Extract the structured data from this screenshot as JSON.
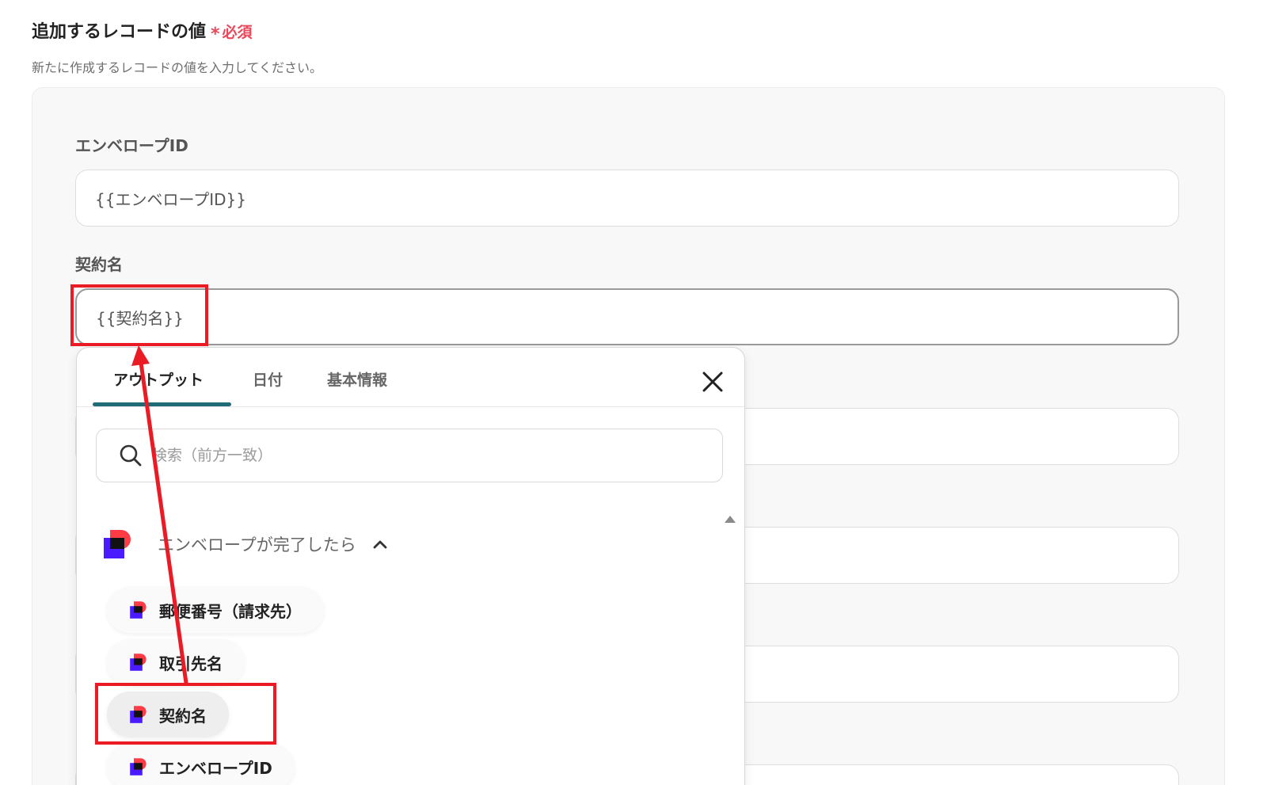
{
  "section": {
    "title": "追加するレコードの値",
    "required_mark": "*",
    "required_label": "必須",
    "description": "新たに作成するレコードの値を入力してください。"
  },
  "fields": [
    {
      "label": "エンベロープID",
      "value": "{{エンベロープID}}"
    },
    {
      "label": "契約名",
      "value": "{{契約名}}"
    }
  ],
  "popup": {
    "tabs": [
      {
        "label": "アウトプット",
        "active": true
      },
      {
        "label": "日付",
        "active": false
      },
      {
        "label": "基本情報",
        "active": false
      }
    ],
    "close_icon": "close-icon",
    "search": {
      "placeholder": "検索（前方一致）",
      "icon": "search-icon"
    },
    "group": {
      "title": "エンベロープが完了したら",
      "icon": "app-logo-icon",
      "expanded": true
    },
    "items": [
      {
        "label": "郵便番号（請求先）",
        "selected": false
      },
      {
        "label": "取引先名",
        "selected": false
      },
      {
        "label": "契約名",
        "selected": true
      },
      {
        "label": "エンベロープID",
        "selected": false
      }
    ]
  },
  "colors": {
    "accent_tab": "#1f6b78",
    "required": "#e8485a",
    "annotation": "#ea1b24",
    "logo_red": "#ff3b45",
    "logo_blue": "#4a1bff"
  }
}
